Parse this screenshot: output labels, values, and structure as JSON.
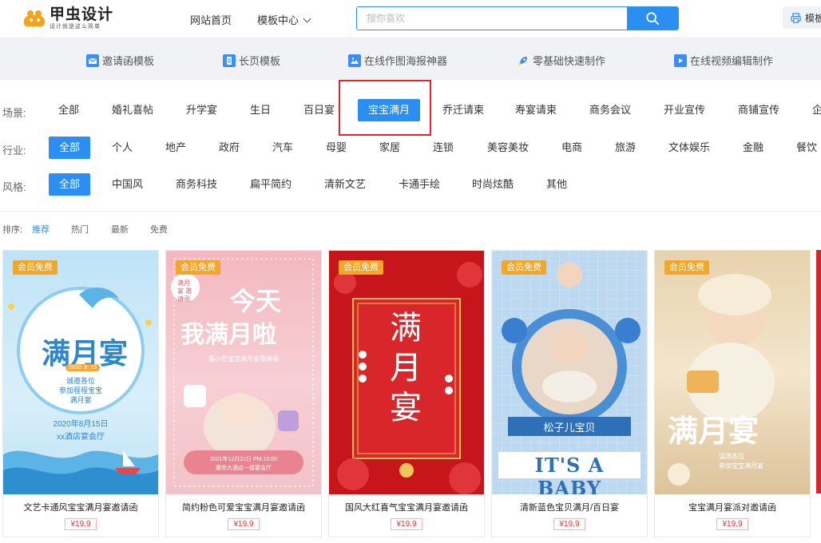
{
  "header": {
    "logo_name": "甲虫设计",
    "logo_slogan": "设计就是这么简单",
    "nav_home": "网站首页",
    "nav_templates": "模板中心",
    "search_placeholder": "搜你喜欢",
    "topright_label": "模板"
  },
  "toolbar": {
    "items": [
      {
        "label": "邀请函模板",
        "icon": "invitation-icon"
      },
      {
        "label": "长页模板",
        "icon": "long-page-icon"
      },
      {
        "label": "在线作图海报神器",
        "icon": "poster-icon"
      },
      {
        "label": "零基础快速制作",
        "icon": "rocket-icon"
      },
      {
        "label": "在线视频编辑制作",
        "icon": "video-icon"
      }
    ]
  },
  "filters": {
    "scene": {
      "label": "场景:",
      "options": [
        "全部",
        "婚礼喜帖",
        "升学宴",
        "生日",
        "百日宴",
        "宝宝满月",
        "乔迁请柬",
        "寿宴请柬",
        "商务会议",
        "开业宣传",
        "商铺宣传",
        "企"
      ],
      "selected": "宝宝满月"
    },
    "industry": {
      "label": "行业:",
      "options": [
        "全部",
        "个人",
        "地产",
        "政府",
        "汽车",
        "母婴",
        "家居",
        "连锁",
        "美容美妆",
        "电商",
        "旅游",
        "文体娱乐",
        "金融",
        "餐饮"
      ],
      "selected": "全部"
    },
    "style": {
      "label": "风格:",
      "options": [
        "全部",
        "中国风",
        "商务科技",
        "扁平简约",
        "清新文艺",
        "卡通手绘",
        "时尚炫酷",
        "其他"
      ],
      "selected": "全部"
    }
  },
  "sort": {
    "label": "排序:",
    "options": [
      "推荐",
      "热门",
      "最新",
      "免费"
    ],
    "selected": "推荐"
  },
  "cards": [
    {
      "badge": "会员免费",
      "title": "文艺卡通风宝宝满月宴邀请函",
      "price": "¥19.9",
      "art": {
        "headline": "满月宴",
        "date": "2020. 8. 15",
        "line1": "诚邀各位",
        "line2": "参加程程宝宝",
        "line3": "满月宴",
        "bottom1": "2020年8月15日",
        "bottom2": "xx酒店宴会厅"
      }
    },
    {
      "badge": "会员免费",
      "title": "简约粉色可爱宝宝满月宴邀请函",
      "price": "¥19.9",
      "art": {
        "tag": "满月宴 邀请函",
        "headline1": "今天",
        "headline2": "我满月啦",
        "sub": "· 晨小芒宝宝满月宴邀请函 ·",
        "info1": "2021年12月22日 PM:10:00",
        "info2": "康帝大酒店一楼宴会厅"
      }
    },
    {
      "badge": "会员免费",
      "title": "国风大红喜气宝宝满月宴邀请函",
      "price": "¥19.9",
      "art": {
        "headline": "满月宴"
      }
    },
    {
      "badge": "会员免费",
      "title": "清新蓝色宝贝满月/百日宴",
      "price": "¥19.9",
      "art": {
        "ribbon": "松子儿宝贝",
        "banner": "IT'S A BABY"
      }
    },
    {
      "badge": "会员免费",
      "title": "宝宝满月宴派对邀请函",
      "price": "¥19.9",
      "art": {
        "headline": "满月宴",
        "sub1": "诚邀各位",
        "sub2": "参加宝宝满月宴"
      }
    }
  ],
  "colors": {
    "accent": "#2b8ef3",
    "badge": "#f4a62a",
    "price": "#e03a3a",
    "highlight": "#e1252b"
  }
}
